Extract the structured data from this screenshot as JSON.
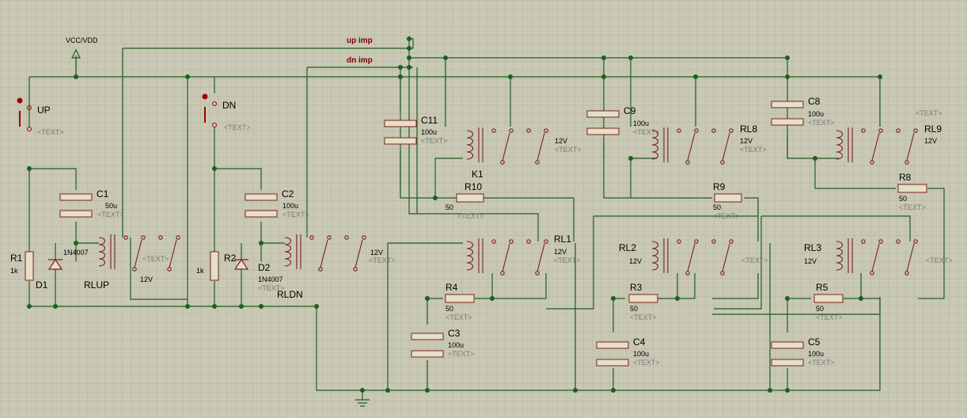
{
  "power": {
    "vcc_label": "VCC/VDD"
  },
  "nets": {
    "up_imp": "up imp",
    "dn_imp": "dn imp"
  },
  "placeholder": "<TEXT>",
  "switches": [
    {
      "ref": "UP"
    },
    {
      "ref": "DN"
    }
  ],
  "resistors": [
    {
      "ref": "R1",
      "value": "1k"
    },
    {
      "ref": "R2",
      "value": "1k"
    },
    {
      "ref": "R10",
      "value": "50"
    },
    {
      "ref": "R9",
      "value": "50"
    },
    {
      "ref": "R8",
      "value": "50"
    },
    {
      "ref": "R4",
      "value": "50"
    },
    {
      "ref": "R3",
      "value": "50"
    },
    {
      "ref": "R5",
      "value": "50"
    }
  ],
  "capacitors": [
    {
      "ref": "C1",
      "value": "50u"
    },
    {
      "ref": "C2",
      "value": "100u"
    },
    {
      "ref": "C11",
      "value": "100u"
    },
    {
      "ref": "C9",
      "value": "100u"
    },
    {
      "ref": "C8",
      "value": "100u"
    },
    {
      "ref": "C3",
      "value": "100u"
    },
    {
      "ref": "C4",
      "value": "100u"
    },
    {
      "ref": "C5",
      "value": "100u"
    }
  ],
  "diodes": [
    {
      "ref": "D1",
      "value": "1N4007"
    },
    {
      "ref": "D2",
      "value": "1N4007"
    }
  ],
  "relays": [
    {
      "ref": "RLUP",
      "value": "12V"
    },
    {
      "ref": "RLDN",
      "value": "12V"
    },
    {
      "ref": "K1",
      "value": "12V"
    },
    {
      "ref": "RL8",
      "value": "12V"
    },
    {
      "ref": "RL9",
      "value": "12V"
    },
    {
      "ref": "RL1",
      "value": "12V"
    },
    {
      "ref": "RL2",
      "value": "12V"
    },
    {
      "ref": "RL3",
      "value": "12V"
    }
  ]
}
